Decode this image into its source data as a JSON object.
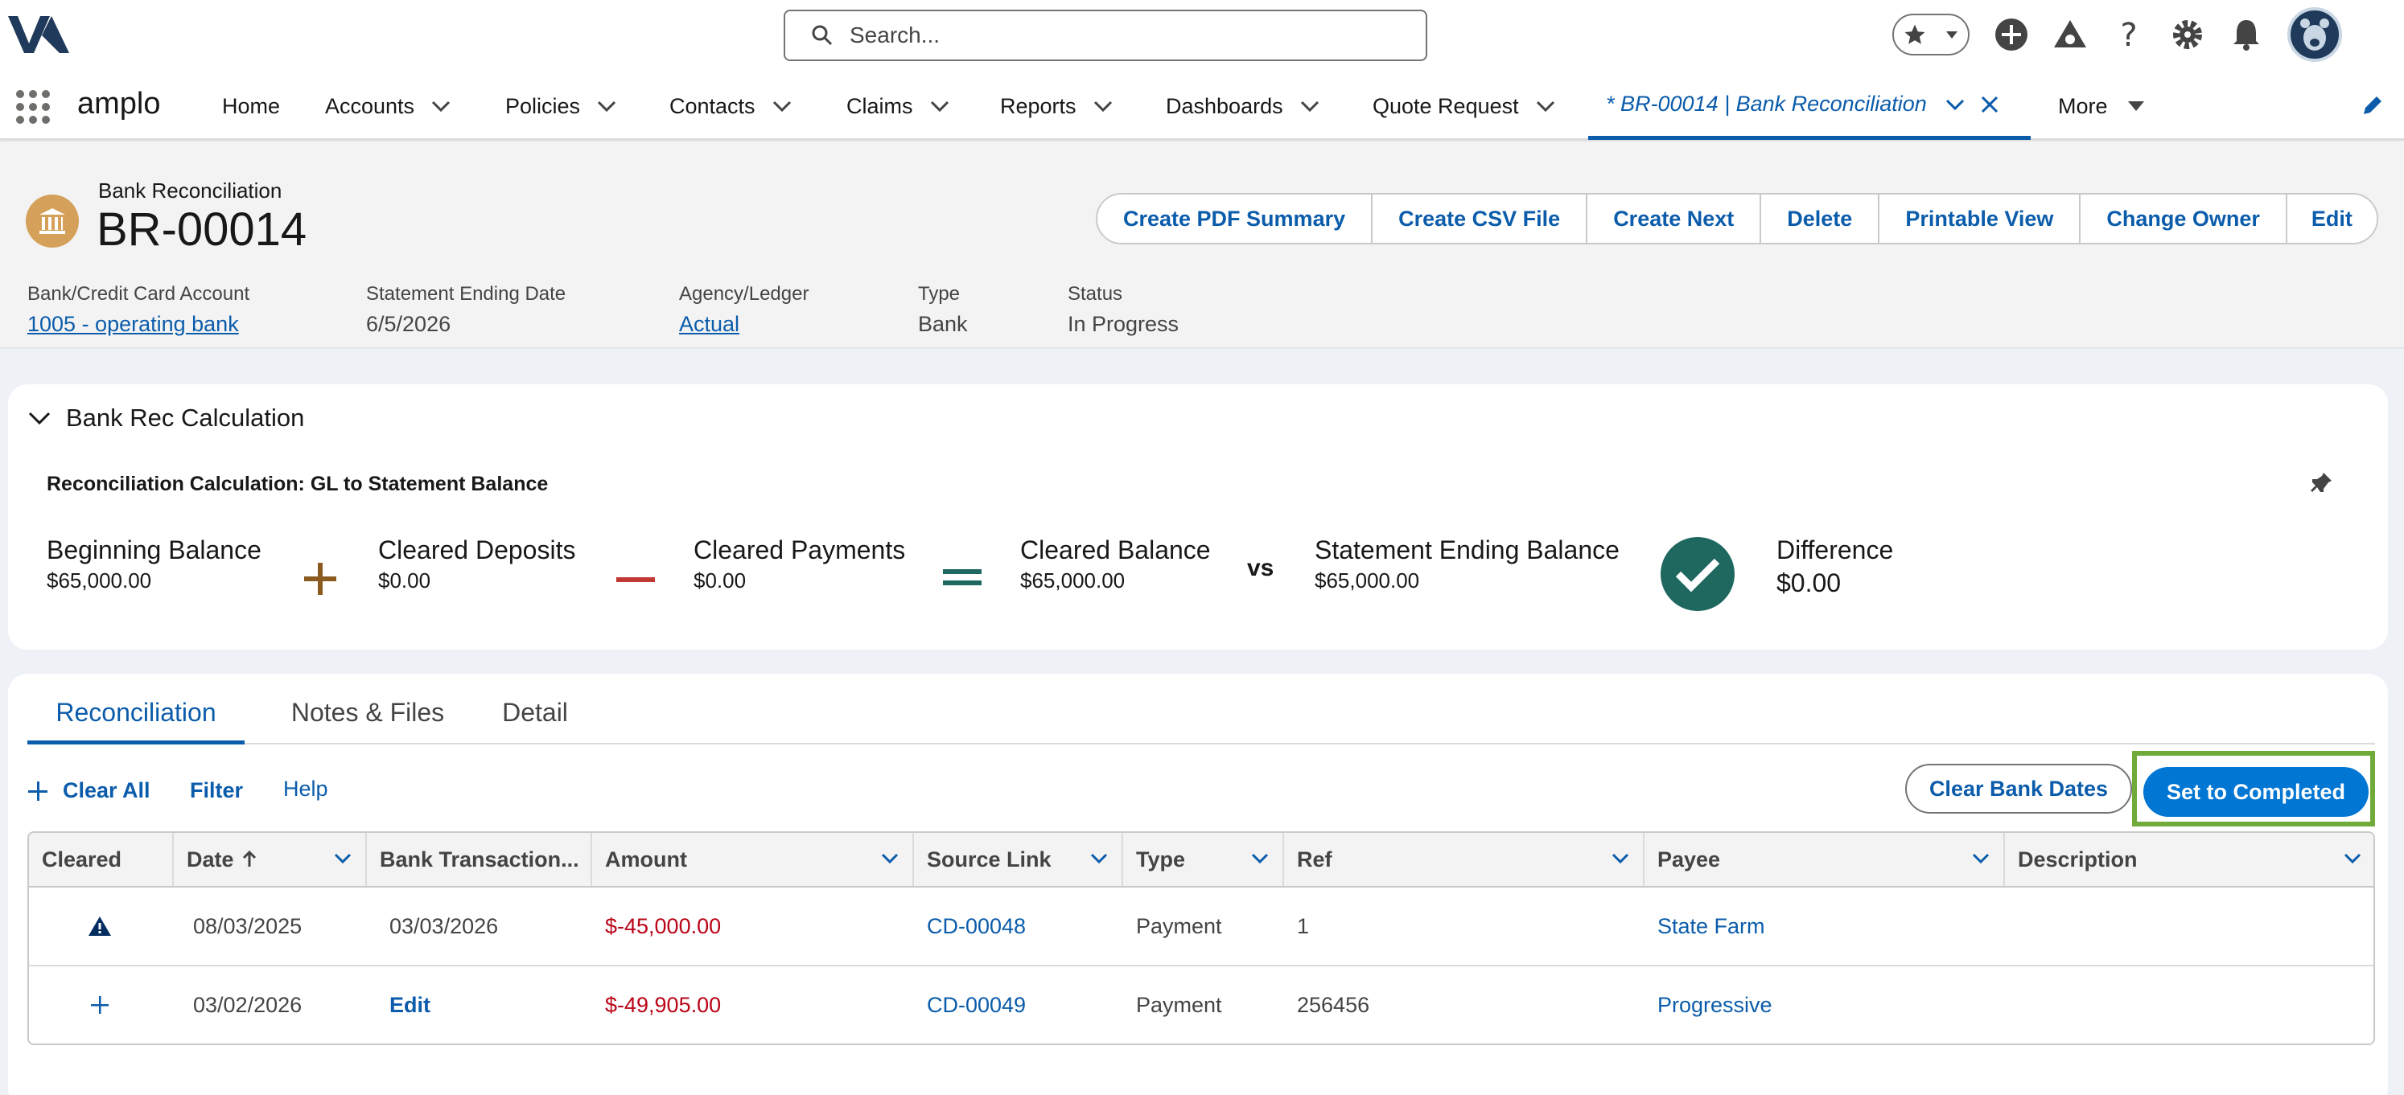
{
  "header": {
    "search_placeholder": "Search..."
  },
  "nav": {
    "app_name": "amplo",
    "items": [
      {
        "label": "Home"
      },
      {
        "label": "Accounts"
      },
      {
        "label": "Policies"
      },
      {
        "label": "Contacts"
      },
      {
        "label": "Claims"
      },
      {
        "label": "Reports"
      },
      {
        "label": "Dashboards"
      },
      {
        "label": "Quote Request"
      }
    ],
    "active_tab": "* BR-00014 | Bank Reconciliation",
    "more": "More"
  },
  "record": {
    "object_type": "Bank Reconciliation",
    "name": "BR-00014",
    "actions": [
      "Create PDF Summary",
      "Create CSV File",
      "Create Next",
      "Delete",
      "Printable View",
      "Change Owner",
      "Edit"
    ],
    "fields": [
      {
        "label": "Bank/Credit Card Account",
        "value": "1005 - operating bank"
      },
      {
        "label": "Statement Ending Date",
        "value": "6/5/2026"
      },
      {
        "label": "Agency/Ledger",
        "value": "Actual"
      },
      {
        "label": "Type",
        "value": "Bank"
      },
      {
        "label": "Status",
        "value": "In Progress"
      }
    ]
  },
  "calc": {
    "section_title": "Bank Rec Calculation",
    "label": "Reconciliation Calculation: GL to Statement Balance",
    "items": [
      {
        "title": "Beginning Balance",
        "value": "$65,000.00"
      },
      {
        "title": "Cleared Deposits",
        "value": "$0.00"
      },
      {
        "title": "Cleared Payments",
        "value": "$0.00"
      },
      {
        "title": "Cleared Balance",
        "value": "$65,000.00"
      },
      {
        "title": "Statement Ending Balance",
        "value": "$65,000.00"
      },
      {
        "title": "Difference",
        "value": "$0.00"
      }
    ],
    "vs": "vs",
    "colors": {
      "plus": "#8a5a1e",
      "minus": "#c23934",
      "equals": "#1e6860",
      "check": "#1e6860"
    }
  },
  "tabs": [
    {
      "label": "Reconciliation"
    },
    {
      "label": "Notes & Files"
    },
    {
      "label": "Detail"
    }
  ],
  "toolbar": {
    "clear_all": "Clear All",
    "filter": "Filter",
    "help": "Help",
    "clear_bank_dates": "Clear Bank Dates",
    "set_completed": "Set to Completed"
  },
  "table": {
    "columns": [
      "Cleared",
      "Date",
      "Bank Transaction...",
      "Amount",
      "Source Link",
      "Type",
      "Ref",
      "Payee",
      "Description"
    ],
    "rows": [
      {
        "cleared_icon": "warning-icon",
        "date": "08/03/2025",
        "bank_txn": "03/03/2026",
        "amount": "$-45,000.00",
        "source": "CD-00048",
        "type": "Payment",
        "ref": "1",
        "payee": "State Farm",
        "description": ""
      },
      {
        "cleared_icon": "add-icon",
        "date": "03/02/2026",
        "bank_txn": "Edit",
        "amount": "$-49,905.00",
        "source": "CD-00049",
        "type": "Payment",
        "ref": "256456",
        "payee": "Progressive",
        "description": ""
      }
    ]
  }
}
